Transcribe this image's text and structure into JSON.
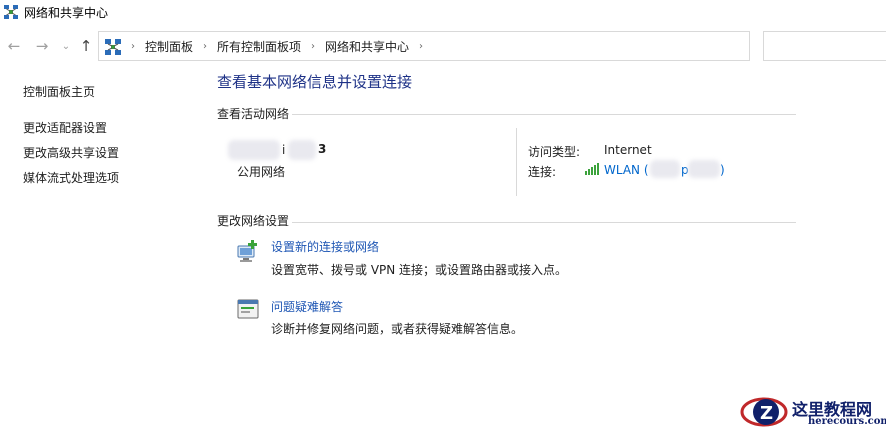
{
  "window": {
    "title": "网络和共享中心",
    "icon": "network-sharing-center-icon"
  },
  "nav": {
    "back_icon": "←",
    "forward_icon": "→",
    "recent_icon": "⌄",
    "up_icon": "↑",
    "breadcrumb": [
      "控制面板",
      "所有控制面板项",
      "网络和共享中心"
    ],
    "breadcrumb_sep": "›",
    "dropdown_icon": "⌄",
    "refresh_icon": "↻",
    "search_placeholder": ""
  },
  "sidebar": {
    "items": [
      {
        "label": "控制面板主页"
      },
      {
        "label": "更改适配器设置"
      },
      {
        "label": "更改高级共享设置"
      },
      {
        "label": "媒体流式处理选项"
      }
    ]
  },
  "main": {
    "title": "查看基本网络信息并设置连接",
    "active_networks_heading": "查看活动网络",
    "network": {
      "name_visible_fragment_1": "i",
      "name_visible_fragment_2": "3",
      "type": "公用网络",
      "access_type_label": "访问类型:",
      "access_type_value": "Internet",
      "connection_label": "连接:",
      "connection_value": "WLAN (",
      "connection_value_mid": "p",
      "connection_value_end": ")",
      "signal_color": "#3ca33c"
    },
    "change_settings_heading": "更改网络设置",
    "tasks": [
      {
        "icon": "new-connection-icon",
        "link": "设置新的连接或网络",
        "desc": "设置宽带、拨号或 VPN 连接；或设置路由器或接入点。"
      },
      {
        "icon": "troubleshoot-icon",
        "link": "问题疑难解答",
        "desc": "诊断并修复网络问题，或者获得疑难解答信息。"
      }
    ]
  },
  "watermark": {
    "line1": "这里教程网",
    "line2": "herecours.com",
    "color": "#10206a",
    "accent": "#c0282a"
  }
}
